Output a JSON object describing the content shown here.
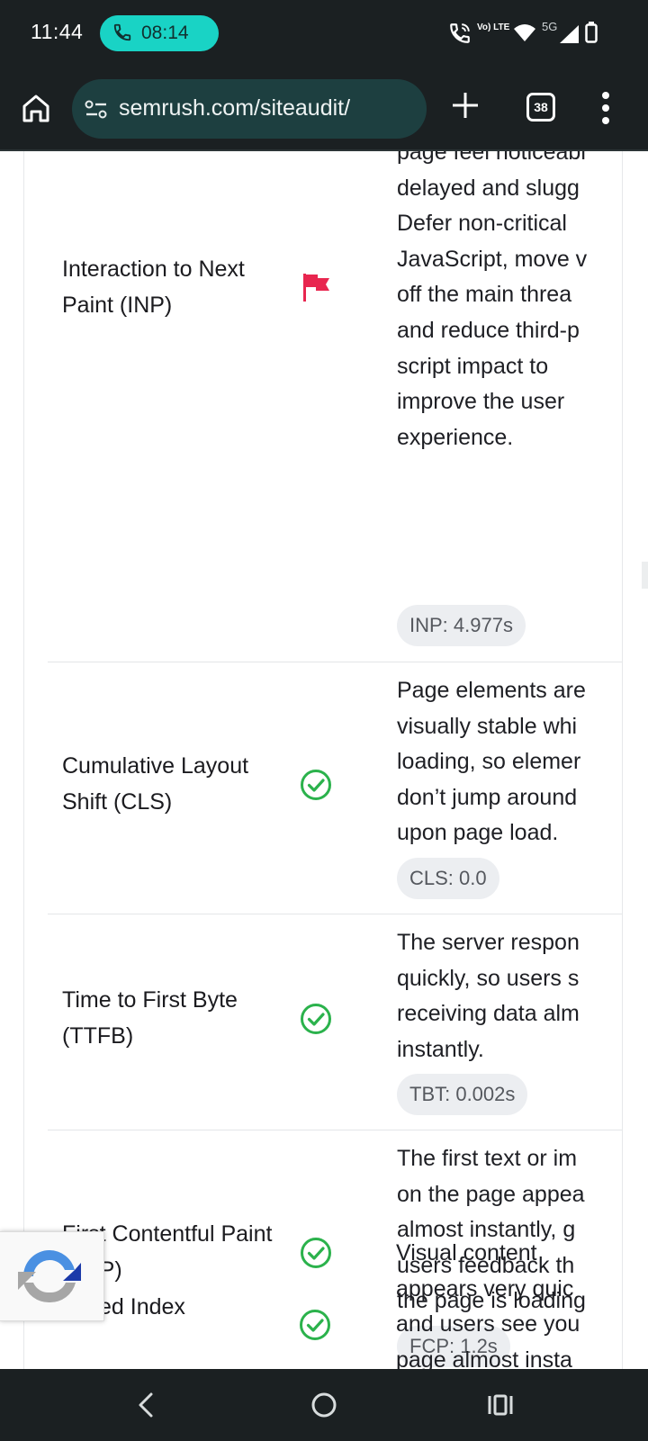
{
  "status_bar": {
    "time": "11:44",
    "call_timer": "08:14",
    "volte_label": "Vo) LTE",
    "network_label": "5G",
    "icons": [
      "phone-in-call-icon",
      "wifi-calling-icon",
      "wifi-icon",
      "signal-icon",
      "battery-icon"
    ]
  },
  "browser": {
    "url": "semrush.com/siteaudit/",
    "tab_count": "38",
    "icons": [
      "home-icon",
      "site-settings-icon",
      "new-tab-icon",
      "tab-switcher-icon",
      "more-menu-icon"
    ]
  },
  "metrics": [
    {
      "label": "Interaction to Next Paint (INP)",
      "status": "flag",
      "status_icon": "red-flag-icon",
      "description_lines": [
        "page feel noticeabl",
        "delayed and slugg",
        "Defer non-critical",
        "JavaScript, move v",
        "off the main threa",
        "and reduce third-p",
        "script impact to",
        "improve the user",
        "experience."
      ],
      "value": "INP: 4.977s"
    },
    {
      "label": "Cumulative Layout Shift (CLS)",
      "status": "good",
      "status_icon": "green-check-icon",
      "description_lines": [
        "Page elements are",
        "visually stable whi",
        "loading, so elemer",
        "don’t jump around",
        "upon page load."
      ],
      "value": "CLS: 0.0"
    },
    {
      "label": "Time to First Byte (TTFB)",
      "status": "good",
      "status_icon": "green-check-icon",
      "description_lines": [
        "The server respon",
        "quickly, so users s",
        "receiving data alm",
        "instantly."
      ],
      "value": "TBT: 0.002s"
    },
    {
      "label": "First Contentful Paint (FCP)",
      "status": "good",
      "status_icon": "green-check-icon",
      "description_lines": [
        "The first text or im",
        "on the page appea",
        "almost instantly, g",
        "users feedback th",
        "the page is loading"
      ],
      "value": "FCP: 1.2s"
    },
    {
      "label": "Speed Index",
      "visible_label": "ed Index",
      "status": "good",
      "status_icon": "green-check-icon",
      "description_lines": [
        "Visual content",
        "appears very quic",
        "and users see you",
        "page almost insta"
      ],
      "value": ""
    }
  ],
  "colors": {
    "flag": "#e8264f",
    "check": "#2bb24c",
    "chip_bg": "#eceef1",
    "chip_text": "#55585e",
    "bar_bg": "#1b2022",
    "url_bg": "#1d3f40",
    "call_pill": "#19d3c5"
  },
  "nav_bar": {
    "icons": [
      "back-icon",
      "home-circle-icon",
      "recents-icon"
    ]
  }
}
